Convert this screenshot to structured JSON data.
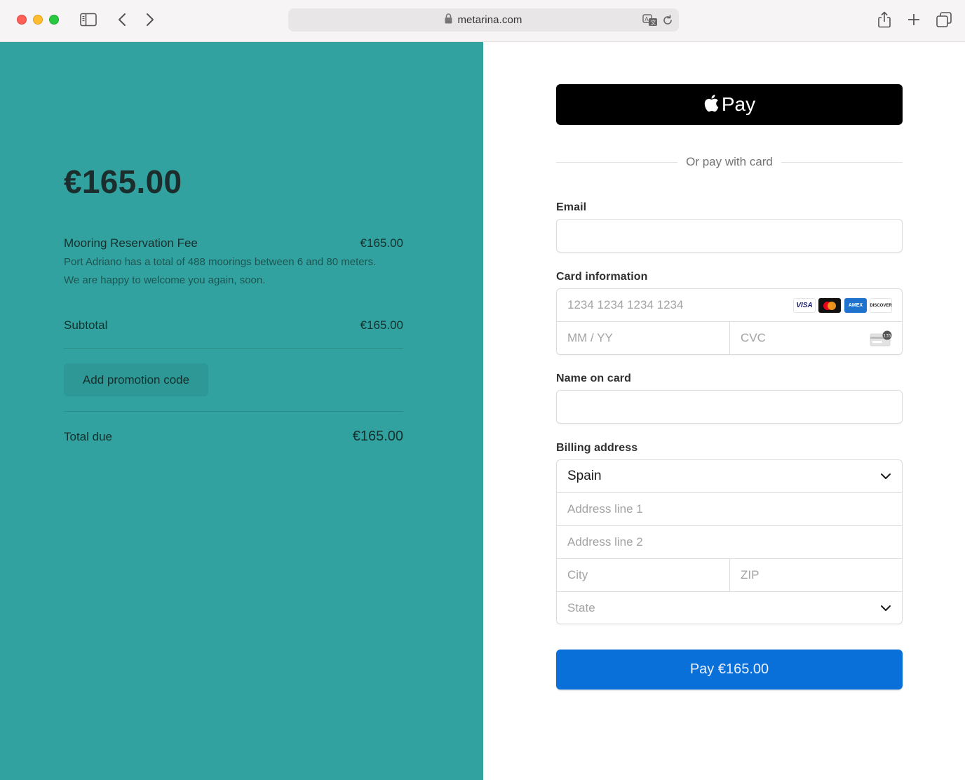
{
  "browser": {
    "url": "metarina.com",
    "icons": [
      "sidebar-icon",
      "back-icon",
      "forward-icon",
      "lock-icon",
      "translate-icon",
      "reload-icon",
      "share-icon",
      "new-tab-icon",
      "tabs-overview-icon"
    ]
  },
  "summary": {
    "amount": "€165.00",
    "item": {
      "name": "Mooring Reservation Fee",
      "price": "€165.00",
      "description": "Port Adriano has a total of 488 moorings between 6 and 80 meters. We are happy to welcome you again, soon."
    },
    "subtotal_label": "Subtotal",
    "subtotal_value": "€165.00",
    "promo_label": "Add promotion code",
    "total_label": "Total due",
    "total_value": "€165.00",
    "background_color": "#31a29f"
  },
  "payment": {
    "apple_pay_label": "Pay",
    "or_text": "Or pay with card",
    "email_label": "Email",
    "email_value": "",
    "card_label": "Card information",
    "card_number_placeholder": "1234 1234 1234 1234",
    "expiry_placeholder": "MM / YY",
    "cvc_placeholder": "CVC",
    "card_brands": [
      "VISA",
      "MASTERCARD",
      "AMEX",
      "DISCOVER"
    ],
    "name_label": "Name on card",
    "name_value": "",
    "billing_label": "Billing address",
    "country_selected": "Spain",
    "address1_placeholder": "Address line 1",
    "address2_placeholder": "Address line 2",
    "city_placeholder": "City",
    "zip_placeholder": "ZIP",
    "state_placeholder": "State",
    "pay_button_label": "Pay €165.00",
    "pay_button_color": "#0a70d9"
  }
}
